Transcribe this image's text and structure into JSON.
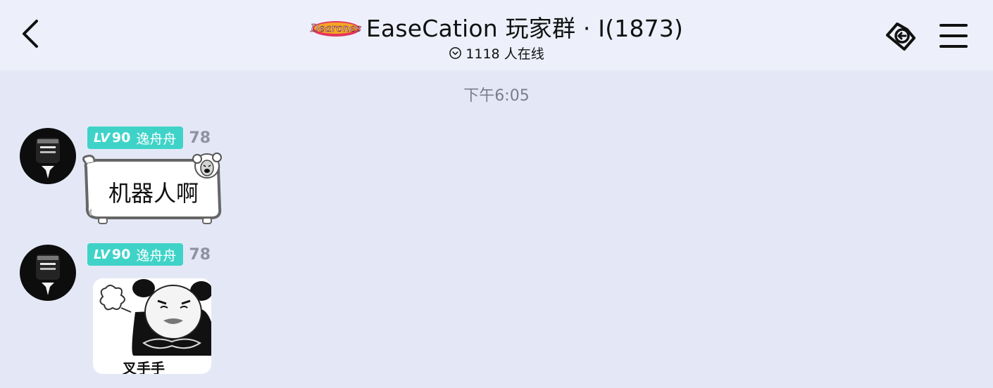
{
  "header": {
    "logo_text": "Dearones",
    "title": "EaseCation 玩家群 · I(1873)",
    "online": "1118 人在线",
    "icons": {
      "back": "chevron-left-icon",
      "online": "chevron-down-circle-icon",
      "right1": "tag-link-icon",
      "menu": "hamburger-menu-icon"
    }
  },
  "time_divider": "下午6:05",
  "messages": [
    {
      "sender": "逸舟舟",
      "level_prefix": "LV",
      "level": "90",
      "extra": "78",
      "type": "text",
      "text": "机器人啊"
    },
    {
      "sender": "逸舟舟",
      "level_prefix": "LV",
      "level": "90",
      "extra": "78",
      "type": "sticker",
      "caption": "叉手手"
    }
  ],
  "colors": {
    "background": "#e4e8f6",
    "header": "#edf0fa",
    "level_badge": "#3fd3c8",
    "muted": "#8d93a1"
  }
}
